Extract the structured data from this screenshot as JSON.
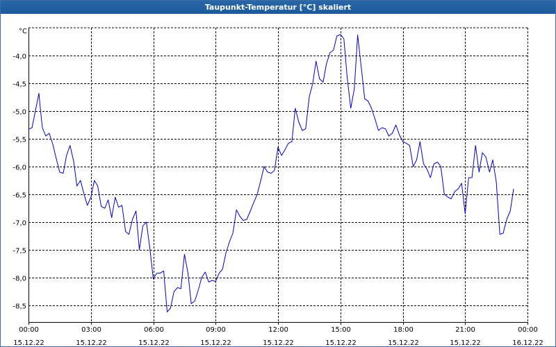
{
  "window": {
    "title": "Taupunkt-Temperatur [°C] skaliert"
  },
  "chart_data": {
    "type": "line",
    "title": "Taupunkt-Temperatur [°C] skaliert",
    "ylabel": "°C",
    "xlabel": "",
    "ylim": [
      -8.8,
      -3.5
    ],
    "xlim_hours": [
      0,
      24
    ],
    "y_ticks": [
      -4.0,
      -4.5,
      -5.0,
      -5.5,
      -6.0,
      -6.5,
      -7.0,
      -7.5,
      -8.0,
      -8.5
    ],
    "y_tick_labels": [
      "-4,0",
      "-4,5",
      "-5,0",
      "-5,5",
      "-6,0",
      "-6,5",
      "-7,0",
      "-7,5",
      "-8,0",
      "-8,5"
    ],
    "x_ticks": [
      {
        "time": "00:00",
        "date": "15.12.22"
      },
      {
        "time": "03:00",
        "date": "15.12.22"
      },
      {
        "time": "06:00",
        "date": "15.12.22"
      },
      {
        "time": "09:00",
        "date": "15.12.22"
      },
      {
        "time": "12:00",
        "date": "15.12.22"
      },
      {
        "time": "15:00",
        "date": "15.12.22"
      },
      {
        "time": "18:00",
        "date": "15.12.22"
      },
      {
        "time": "21:00",
        "date": "15.12.22"
      },
      {
        "time": "00:00",
        "date": "16.12.22"
      }
    ],
    "grid": true,
    "series": [
      {
        "color": "#0000cc",
        "x_hours": [
          0.0,
          0.17,
          0.33,
          0.5,
          0.58,
          0.67,
          0.83,
          1.0,
          1.17,
          1.33,
          1.5,
          1.67,
          1.83,
          2.0,
          2.17,
          2.33,
          2.5,
          2.67,
          2.83,
          3.0,
          3.17,
          3.33,
          3.5,
          3.67,
          3.83,
          4.0,
          4.17,
          4.33,
          4.5,
          4.67,
          4.83,
          5.0,
          5.17,
          5.33,
          5.5,
          5.67,
          5.83,
          6.0,
          6.17,
          6.33,
          6.5,
          6.67,
          6.83,
          7.0,
          7.17,
          7.33,
          7.5,
          7.67,
          7.83,
          8.0,
          8.17,
          8.33,
          8.5,
          8.67,
          8.83,
          9.0,
          9.17,
          9.33,
          9.5,
          9.67,
          9.83,
          10.0,
          10.17,
          10.33,
          10.5,
          10.67,
          10.83,
          11.0,
          11.17,
          11.33,
          11.5,
          11.67,
          11.83,
          12.0,
          12.17,
          12.33,
          12.5,
          12.67,
          12.83,
          13.0,
          13.17,
          13.33,
          13.5,
          13.67,
          13.83,
          14.0,
          14.17,
          14.33,
          14.5,
          14.67,
          14.83,
          15.0,
          15.17,
          15.33,
          15.5,
          15.67,
          15.83,
          16.0,
          16.17,
          16.33,
          16.5,
          16.67,
          16.83,
          17.0,
          17.17,
          17.33,
          17.5,
          17.67,
          17.83,
          18.0,
          18.17,
          18.33,
          18.5,
          18.67,
          18.83,
          19.0,
          19.17,
          19.33,
          19.5,
          19.67,
          19.83,
          20.0,
          20.17,
          20.33,
          20.5,
          20.67,
          20.83,
          21.0,
          21.17,
          21.33,
          21.5,
          21.67,
          21.83,
          22.0,
          22.17,
          22.33,
          22.5,
          22.67,
          22.83,
          23.0,
          23.17,
          23.33,
          23.5,
          23.67,
          23.83
        ],
        "y": [
          -5.33,
          -5.3,
          -5.0,
          -4.68,
          -5.0,
          -5.3,
          -5.45,
          -5.4,
          -5.6,
          -5.85,
          -6.1,
          -6.12,
          -5.8,
          -5.62,
          -5.9,
          -6.35,
          -6.25,
          -6.5,
          -6.7,
          -6.55,
          -6.25,
          -6.35,
          -6.72,
          -6.75,
          -6.6,
          -6.92,
          -6.55,
          -6.73,
          -6.7,
          -7.17,
          -7.22,
          -6.95,
          -6.8,
          -7.5,
          -7.07,
          -7.0,
          -7.45,
          -8.02,
          -7.92,
          -7.92,
          -7.88,
          -8.62,
          -8.55,
          -8.25,
          -8.18,
          -8.2,
          -7.58,
          -7.92,
          -8.47,
          -8.42,
          -8.22,
          -8.0,
          -7.9,
          -8.08,
          -8.05,
          -8.07,
          -7.92,
          -7.85,
          -7.55,
          -7.35,
          -7.2,
          -6.78,
          -6.9,
          -6.97,
          -6.95,
          -6.8,
          -6.65,
          -6.5,
          -6.25,
          -6.0,
          -6.1,
          -6.12,
          -6.07,
          -5.65,
          -5.8,
          -5.7,
          -5.58,
          -5.55,
          -4.95,
          -5.2,
          -5.35,
          -5.32,
          -4.75,
          -4.5,
          -4.1,
          -4.42,
          -4.48,
          -4.15,
          -3.95,
          -3.9,
          -3.65,
          -3.62,
          -3.7,
          -4.4,
          -4.95,
          -4.6,
          -3.63,
          -4.2,
          -4.78,
          -4.82,
          -4.95,
          -5.15,
          -5.35,
          -5.3,
          -5.32,
          -5.45,
          -5.4,
          -5.25,
          -5.42,
          -5.55,
          -5.58,
          -5.62,
          -6.0,
          -5.88,
          -5.55,
          -5.95,
          -6.05,
          -6.2,
          -5.95,
          -5.92,
          -6.0,
          -6.5,
          -6.55,
          -6.58,
          -6.45,
          -6.4,
          -6.3,
          -6.85,
          -6.2,
          -6.2,
          -5.62,
          -6.1,
          -5.75,
          -5.83,
          -6.1,
          -5.88,
          -6.28,
          -7.22,
          -7.2,
          -6.95,
          -6.8,
          -6.4
        ]
      }
    ]
  }
}
